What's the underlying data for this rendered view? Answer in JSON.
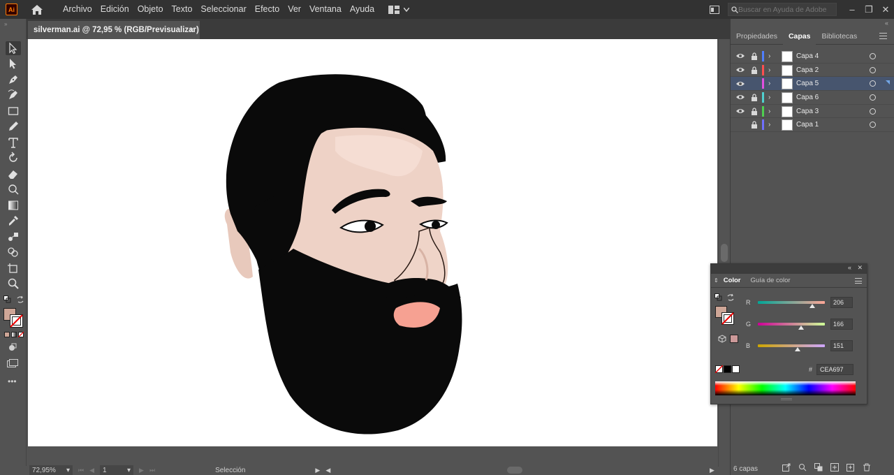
{
  "app": {
    "logo_text": "Ai",
    "menu": [
      "Archivo",
      "Edición",
      "Objeto",
      "Texto",
      "Seleccionar",
      "Efecto",
      "Ver",
      "Ventana",
      "Ayuda"
    ],
    "search_placeholder": "Buscar en Ayuda de Adobe"
  },
  "document_tab": {
    "title": "silverman.ai @ 72,95 % (RGB/Previsualizar)",
    "close": "×"
  },
  "tools": [
    "selection-tool",
    "direct-selection-tool",
    "pen-tool",
    "curvature-tool",
    "rectangle-tool",
    "pencil-tool",
    "type-tool",
    "rotate-tool",
    "eraser-tool",
    "scale-tool",
    "gradient-tool",
    "eyedropper-tool",
    "blend-tool",
    "shape-builder-tool",
    "artboard-tool",
    "zoom-tool"
  ],
  "status": {
    "zoom": "72,95%",
    "page": "1",
    "mode": "Selección"
  },
  "right_panel": {
    "tabs": [
      "Propiedades",
      "Capas",
      "Bibliotecas"
    ],
    "active_tab": "Capas",
    "layers": [
      {
        "name": "Capa 4",
        "visible": true,
        "locked": true,
        "color": "#4f7fff",
        "selected": false
      },
      {
        "name": "Capa 2",
        "visible": true,
        "locked": true,
        "color": "#ff4f4f",
        "selected": false
      },
      {
        "name": "Capa 5",
        "visible": true,
        "locked": false,
        "color": "#e050e0",
        "selected": true
      },
      {
        "name": "Capa 6",
        "visible": true,
        "locked": true,
        "color": "#4fd0d0",
        "selected": false
      },
      {
        "name": "Capa 3",
        "visible": true,
        "locked": true,
        "color": "#4fcf4f",
        "selected": false
      },
      {
        "name": "Capa 1",
        "visible": false,
        "locked": true,
        "color": "#6f6fff",
        "selected": false
      }
    ],
    "layer_count": "6 capas"
  },
  "color_panel": {
    "tabs": [
      "Color",
      "Guía de color"
    ],
    "active_tab": "Color",
    "R": "206",
    "G": "166",
    "B": "151",
    "R_value": 206,
    "G_value": 166,
    "B_value": 151,
    "hex_label": "#",
    "hex": "CEA697",
    "fill_color": "#CEA697"
  }
}
